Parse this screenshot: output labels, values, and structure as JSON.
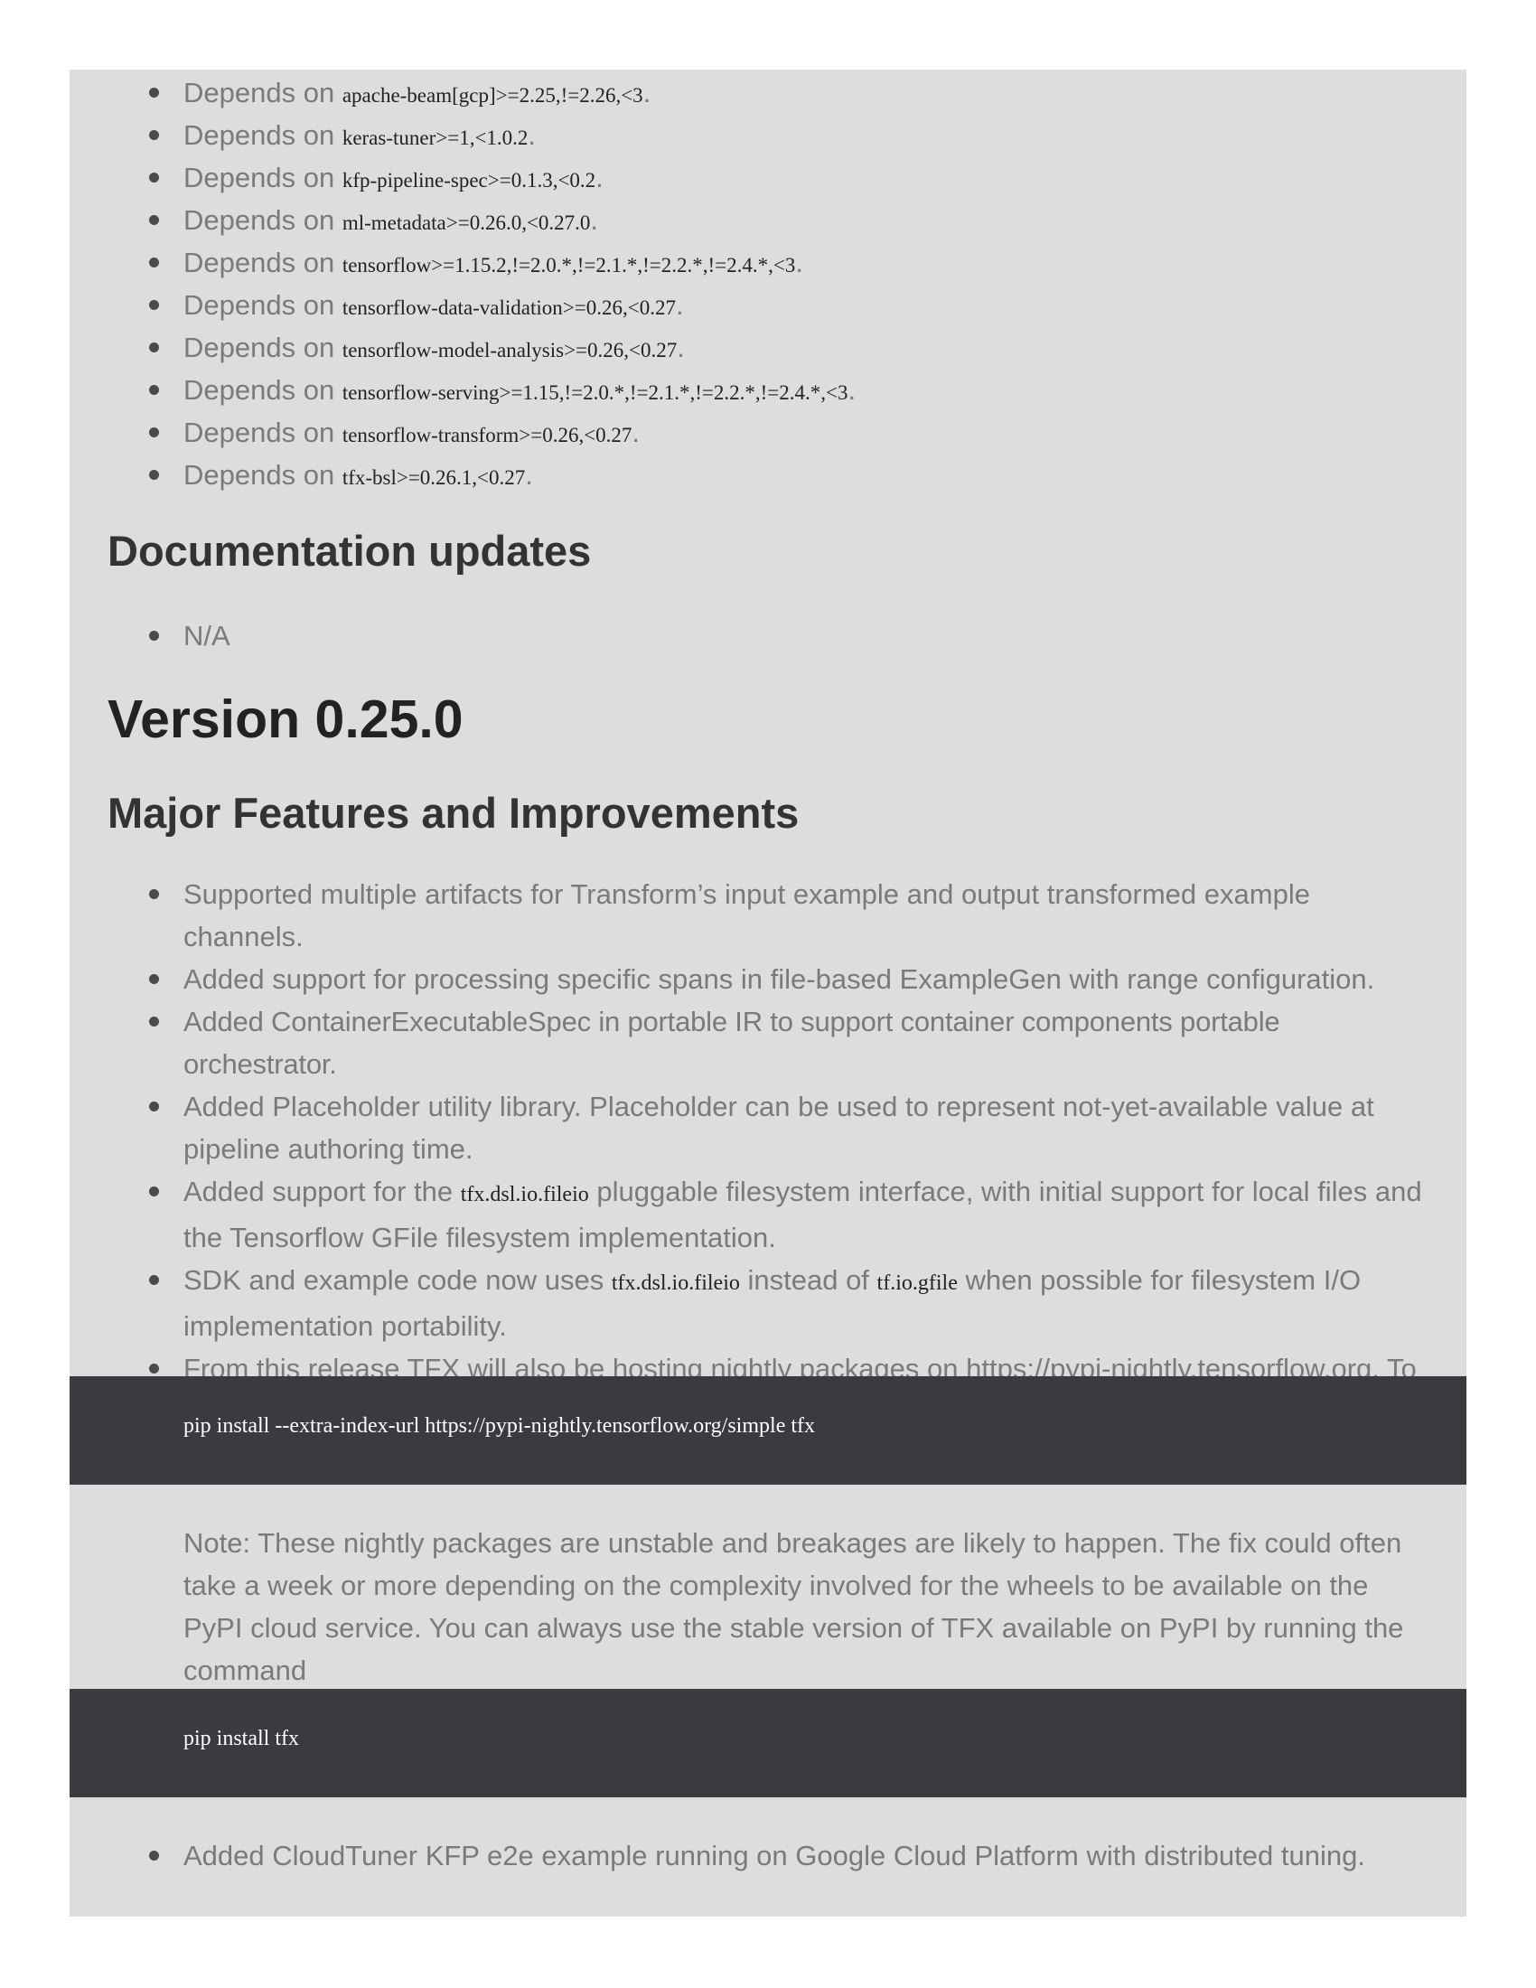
{
  "dependencies": {
    "prefix": "Depends on",
    "items": [
      "apache-beam[gcp]>=2.25,!=2.26,<3",
      "keras-tuner>=1,<1.0.2",
      "kfp-pipeline-spec>=0.1.3,<0.2",
      "ml-metadata>=0.26.0,<0.27.0",
      "tensorflow>=1.15.2,!=2.0.*,!=2.1.*,!=2.2.*,!=2.4.*,<3",
      "tensorflow-data-validation>=0.26,<0.27",
      "tensorflow-model-analysis>=0.26,<0.27",
      "tensorflow-serving>=1.15,!=2.0.*,!=2.1.*,!=2.2.*,!=2.4.*,<3",
      "tensorflow-transform>=0.26,<0.27",
      "tfx-bsl>=0.26.1,<0.27"
    ]
  },
  "documentation_updates": {
    "heading": "Documentation updates",
    "items": [
      "N/A"
    ]
  },
  "version": {
    "heading": "Version 0.25.0"
  },
  "major_features": {
    "heading": "Major Features and Improvements",
    "item1": "Supported multiple artifacts for Transform’s input example and output transformed example channels.",
    "item2": "Added support for processing specific spans in file-based ExampleGen with range configuration.",
    "item3": "Added ContainerExecutableSpec in portable IR to support container components portable orchestrator.",
    "item4": "Added Placeholder utility library. Placeholder can be used to represent not-yet-available value at pipeline authoring time.",
    "item5": {
      "before": "Added support for the ",
      "code": "tfx.dsl.io.fileio",
      "after": " pluggable filesystem interface, with initial support for local files and the Tensorflow GFile filesystem implementation."
    },
    "item6": {
      "before": "SDK and example code now uses ",
      "code1": "tfx.dsl.io.fileio",
      "middle": " instead of ",
      "code2": "tf.io.gfile",
      "after": " when possible for filesystem I/O implementation portability."
    },
    "item7": "From this release TFX will also be hosting nightly packages on https://pypi-nightly.tensorflow.org. To install the nightly package use the following command:",
    "code_block1": "pip install --extra-index-url https://pypi-nightly.tensorflow.org/simple tfx",
    "note": "Note: These nightly packages are unstable and breakages are likely to happen. The fix could often take a week or more depending on the complexity involved for the wheels to be available on the PyPI cloud service. You can always use the stable version of TFX available on PyPI by running the command",
    "code_block2": "pip install tfx",
    "item8": "Added CloudTuner KFP e2e example running on Google Cloud Platform with distributed tuning."
  }
}
